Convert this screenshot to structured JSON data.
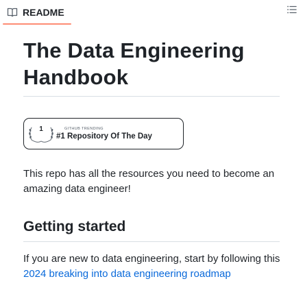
{
  "tabbar": {
    "readme_tab_label": "README",
    "book_icon": "book-icon",
    "menu_icon": "list-unordered-icon",
    "accent_color": "#fd8c73"
  },
  "readme": {
    "title": "The Data Engineering Handbook",
    "badge": {
      "rank": "1",
      "caption": "GITHUB TRENDING",
      "text": "#1 Repository Of The Day"
    },
    "intro": "This repo has all the resources you need to become an amazing data engineer!",
    "section_heading": "Getting started",
    "paragraph_prefix": "If you are new to data engineering, start by following this ",
    "paragraph_link": "2024 breaking into data engineering roadmap",
    "link_color": "#0969da"
  }
}
